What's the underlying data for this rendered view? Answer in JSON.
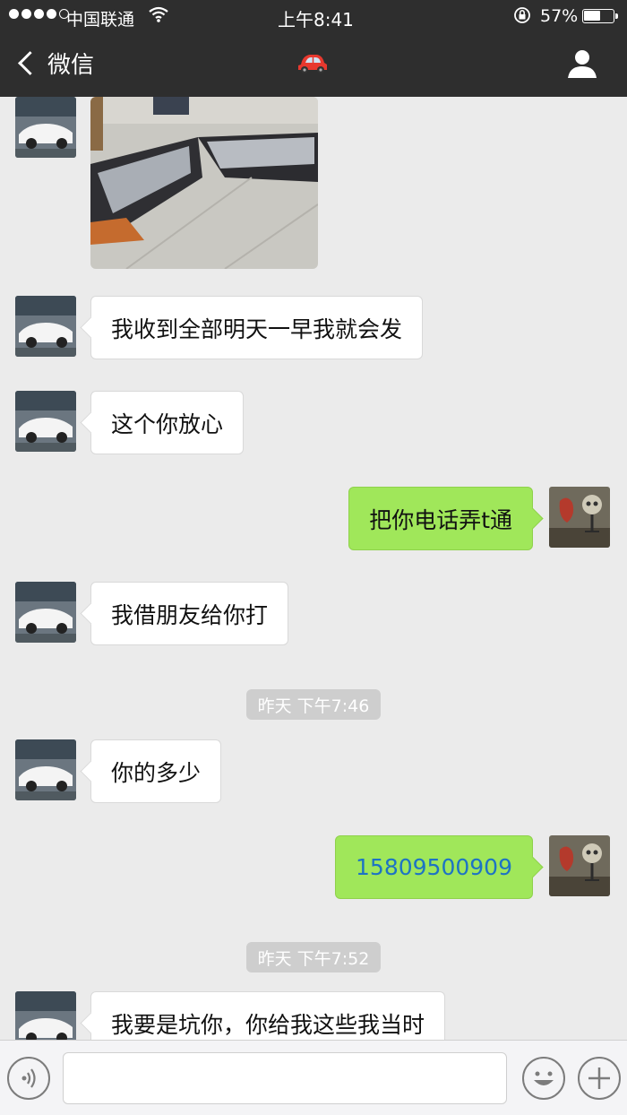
{
  "status_bar": {
    "carrier": "中国联通",
    "time": "上午8:41",
    "battery_percent": "57%",
    "battery_level": 0.57
  },
  "nav": {
    "back_label": "微信",
    "title_icon": "red-car-emoji",
    "right_icon": "profile-icon"
  },
  "messages": [
    {
      "side": "left",
      "type": "image",
      "desc": "photo"
    },
    {
      "side": "left",
      "text": "我收到全部明天一早我就会发"
    },
    {
      "side": "left",
      "text": "这个你放心"
    },
    {
      "side": "right",
      "text": "把你电话弄t通"
    },
    {
      "side": "left",
      "text": "我借朋友给你打"
    },
    {
      "type": "timestamp",
      "text": "昨天 下午7:46"
    },
    {
      "side": "left",
      "text": "你的多少"
    },
    {
      "side": "right",
      "text": "15809500909"
    },
    {
      "type": "timestamp",
      "text": "昨天 下午7:52"
    },
    {
      "side": "left",
      "text": "我要是坑你，你给我这些我当时"
    }
  ],
  "input_bar": {
    "voice_icon": "voice-icon",
    "emoji_icon": "emoji-icon",
    "add_icon": "plus-icon"
  },
  "colors": {
    "header_bg": "#2e2e2e",
    "chat_bg": "#ebebeb",
    "own_bubble": "#a0e75a",
    "phone_link": "#1d73c4"
  }
}
